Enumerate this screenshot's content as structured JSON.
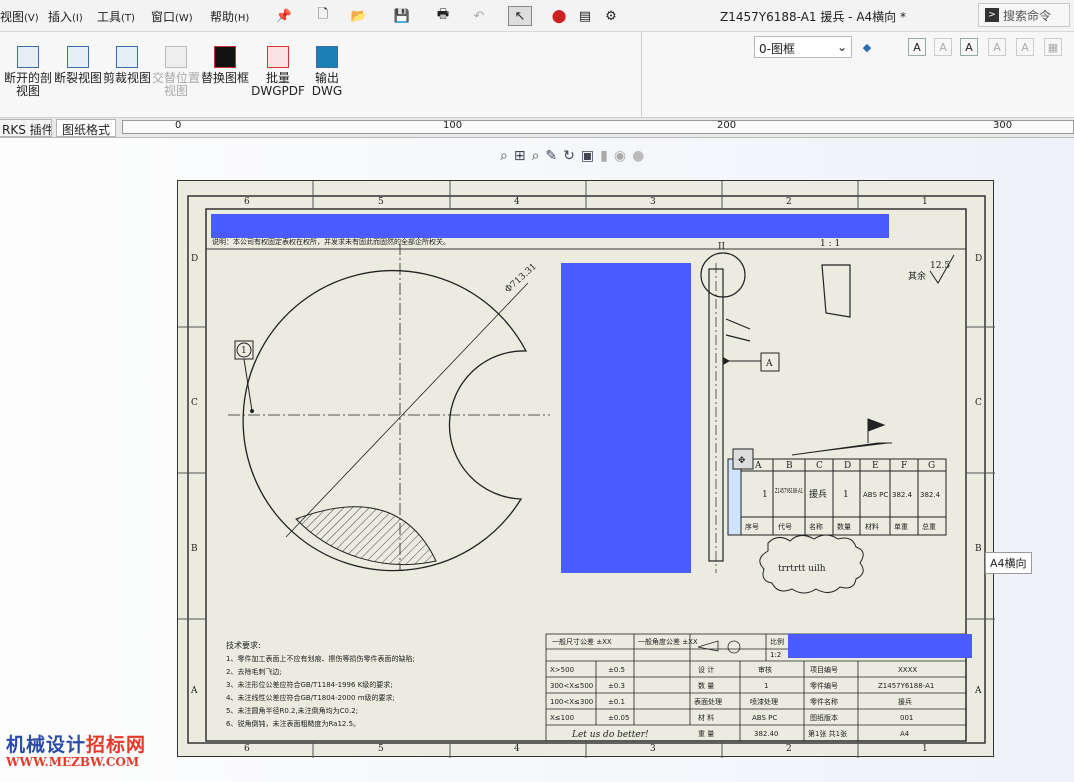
{
  "menubar": {
    "items": [
      {
        "label": "视图",
        "key": "(V)"
      },
      {
        "label": "插入",
        "key": "(I)"
      },
      {
        "label": "工具",
        "key": "(T)"
      },
      {
        "label": "窗口",
        "key": "(W)"
      },
      {
        "label": "帮助",
        "key": "(H)"
      }
    ],
    "window_title": "Z1457Y6188-A1 援兵 - A4横向 *",
    "search_label": "搜索命令"
  },
  "ribbon": {
    "buttons": [
      {
        "label": "断开的剖视图",
        "icon": "broken-section-icon",
        "enabled": true
      },
      {
        "label": "断裂视图",
        "icon": "break-view-icon",
        "enabled": true
      },
      {
        "label": "剪裁视图",
        "icon": "crop-view-icon",
        "enabled": true
      },
      {
        "label": "交替位置视图",
        "icon": "alternate-position-icon",
        "enabled": false
      },
      {
        "label": "替换图框",
        "icon": "replace-frame-icon",
        "enabled": true
      },
      {
        "label": "批量DWGPDF",
        "icon": "batch-pdf-icon",
        "enabled": true
      },
      {
        "label": "输出DWG",
        "icon": "export-dwg-icon",
        "enabled": true
      }
    ],
    "layer_value": "0-图框"
  },
  "tabs": [
    {
      "label": "RKS 插件"
    },
    {
      "label": "图纸格式"
    }
  ],
  "ruler": {
    "marks": [
      "0",
      "100",
      "200",
      "300"
    ]
  },
  "sheet": {
    "col_labels_top": [
      "6",
      "5",
      "4",
      "3",
      "2",
      "1"
    ],
    "row_labels": [
      "D",
      "C",
      "B",
      "A"
    ],
    "header_note": "说明：本公司有权固定表权在权所，并发求未有固此而固然的全部企所权关。",
    "scale_text": "1 : 1",
    "detail_label": "II",
    "surface_symbol": "12.5",
    "other_text": "其余",
    "dimension": "Φ713.31",
    "balloon_1": "1",
    "datum_a": "A",
    "bom": {
      "headers": [
        "A",
        "B",
        "C",
        "D",
        "E",
        "F",
        "G"
      ],
      "row": [
        "1",
        "Z1457Y6188-A1",
        "援兵",
        "1",
        "ABS PC",
        "382.4",
        "382.4"
      ],
      "footer": [
        "序号",
        "代号",
        "名称",
        "数量",
        "材料",
        "单重",
        "总重"
      ]
    },
    "cloud_text": "trrtrtt uilh",
    "tech_title": "技术要求:",
    "tech_lines": [
      "1、零件加工表面上不应有划痕、擦伤等损伤零件表面的缺陷;",
      "2、去除毛刺飞边;",
      "3、未注形位公差应符合GB/T1184-1996 K级的要求;",
      "4、未注线性公差应符合GB/T1804-2000 m级的要求;",
      "5、未注圆角半径R0.2,未注倒角均为C0.2;",
      "6、锐角倒钝，未注表面粗糙度为Ra12.5。"
    ],
    "title_block": {
      "tol_header_1": "一般尺寸公差 ±XX",
      "tol_header_2": "一般角度公差 ±XX",
      "ratio_label": "比例",
      "ratio_value": "1:2",
      "motto": "Let us do better!",
      "rows": [
        [
          "设 计",
          "审核",
          "项目编号",
          "XXXX"
        ],
        [
          "数 量",
          "1",
          "零件编号",
          "Z1457Y6188-A1"
        ],
        [
          "表面处理",
          "喷漆处理",
          "零件名称",
          "援兵"
        ],
        [
          "材 料",
          "ABS PC",
          "图纸版本",
          "001"
        ],
        [
          "重 量",
          "382.40",
          "第1张 共1张",
          "A4"
        ]
      ],
      "tol_rows": [
        [
          "X>500",
          "±0.5"
        ],
        [
          "300<X≤500",
          "±0.3"
        ],
        [
          "100<X≤300",
          "±0.1"
        ],
        [
          "X≤100",
          "±0.05"
        ]
      ]
    }
  },
  "tooltip": "A4横向",
  "watermark": {
    "line1_a": "机械设计",
    "line1_b": "招标网",
    "line2": "WWW.MEZBW.COM"
  },
  "colors": {
    "highlight": "#4a5cff",
    "accent": "#3a6ea5"
  }
}
